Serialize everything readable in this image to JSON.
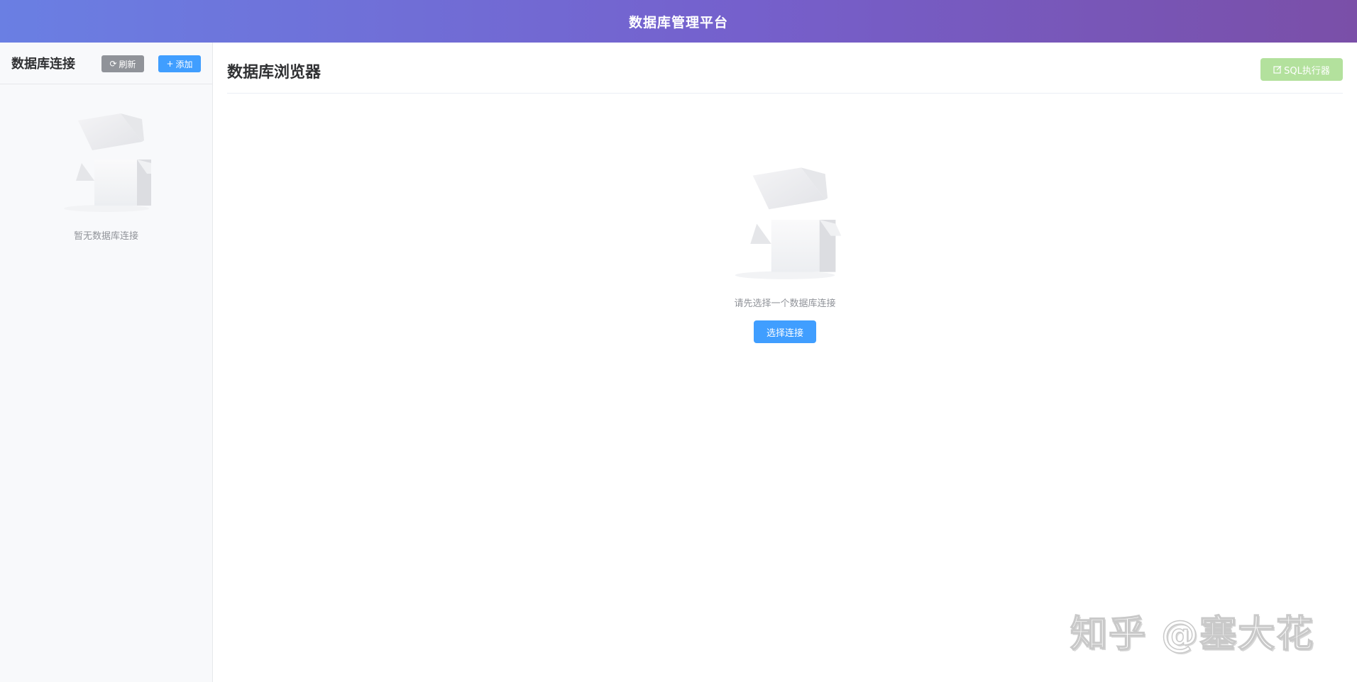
{
  "header": {
    "title": "数据库管理平台"
  },
  "sidebar": {
    "title": "数据库连接",
    "refresh_label": "刷新",
    "refresh_icon": "refresh-icon",
    "add_label": "添加",
    "add_icon": "plus-icon",
    "empty_text": "暂无数据库连接"
  },
  "main": {
    "title": "数据库浏览器",
    "sql_button_label": "SQL执行器",
    "sql_button_icon": "edit-icon",
    "empty_text": "请先选择一个数据库连接",
    "select_button_label": "选择连接"
  },
  "watermark": {
    "text": "知乎 @塞大花"
  },
  "colors": {
    "header_gradient_start": "#6a7fe3",
    "header_gradient_end": "#7a4fa8",
    "primary": "#409eff",
    "info": "#909399",
    "success_disabled": "#b3e19d"
  }
}
